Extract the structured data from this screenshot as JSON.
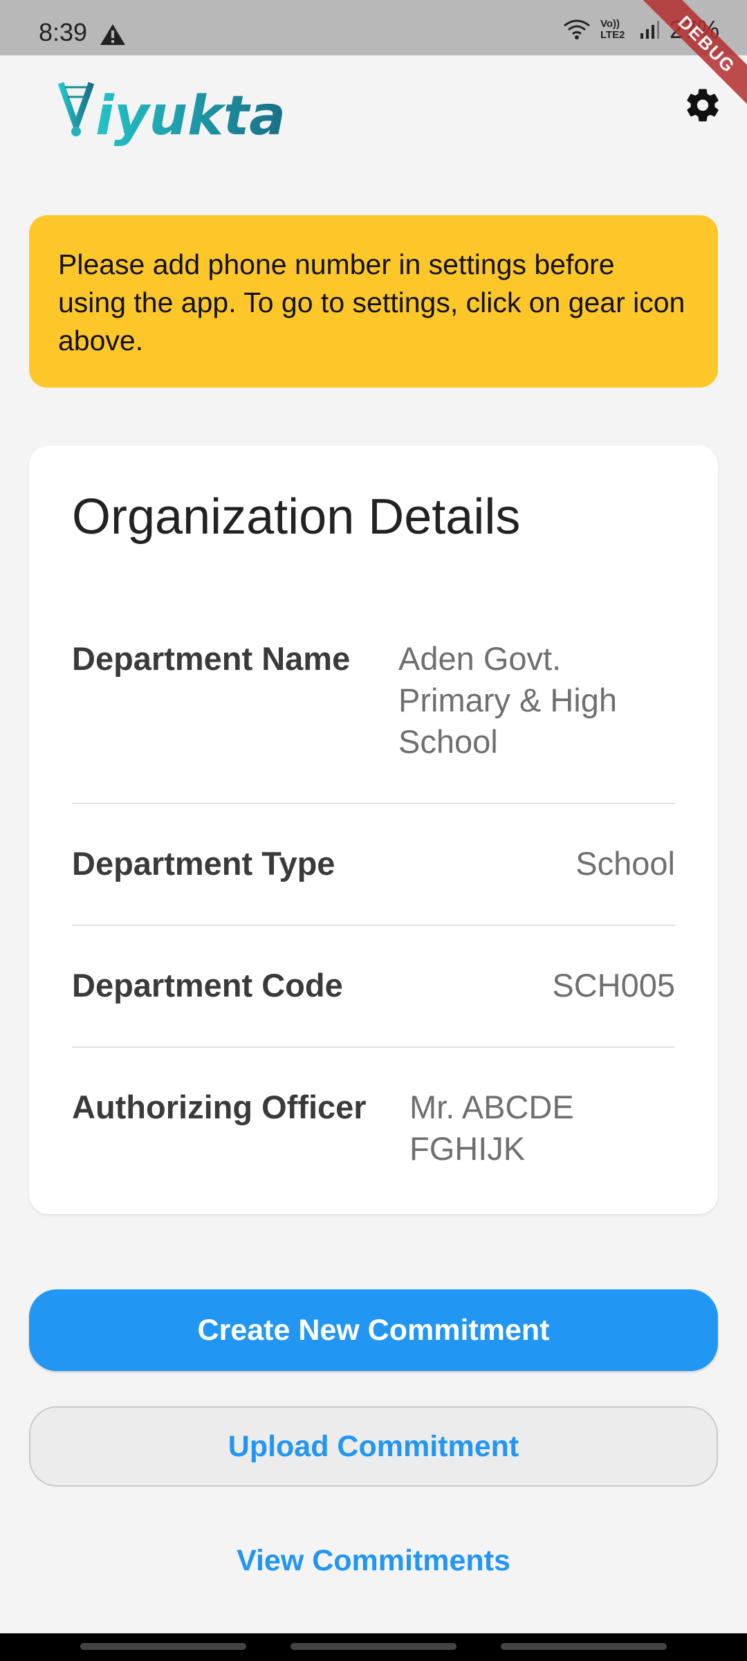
{
  "status_bar": {
    "time": "8:39",
    "network_label": "Vo)) LTE2",
    "battery": "27%",
    "debug_label": "DEBUG"
  },
  "app": {
    "logo_text": "Viyukta",
    "brand_color": "#1a9aa5"
  },
  "alert": {
    "message": "Please add phone number in settings before using the app. To go to settings, click on gear icon above.",
    "color": "#fdc72a"
  },
  "card": {
    "title": "Organization Details",
    "rows": [
      {
        "label": "Department Name",
        "value": "Aden Govt. Primary & High School"
      },
      {
        "label": "Department Type",
        "value": "School"
      },
      {
        "label": "Department Code",
        "value": "SCH005"
      },
      {
        "label": "Authorizing Officer",
        "value": "Mr. ABCDE FGHIJK"
      }
    ]
  },
  "actions": {
    "create_label": "Create New Commitment",
    "upload_label": "Upload Commitment",
    "view_label": "View Commitments",
    "accent": "#2196f3"
  },
  "icons": {
    "settings": "gear-icon",
    "warning": "warning-icon",
    "wifi": "wifi-icon",
    "signal": "signal-icon"
  }
}
